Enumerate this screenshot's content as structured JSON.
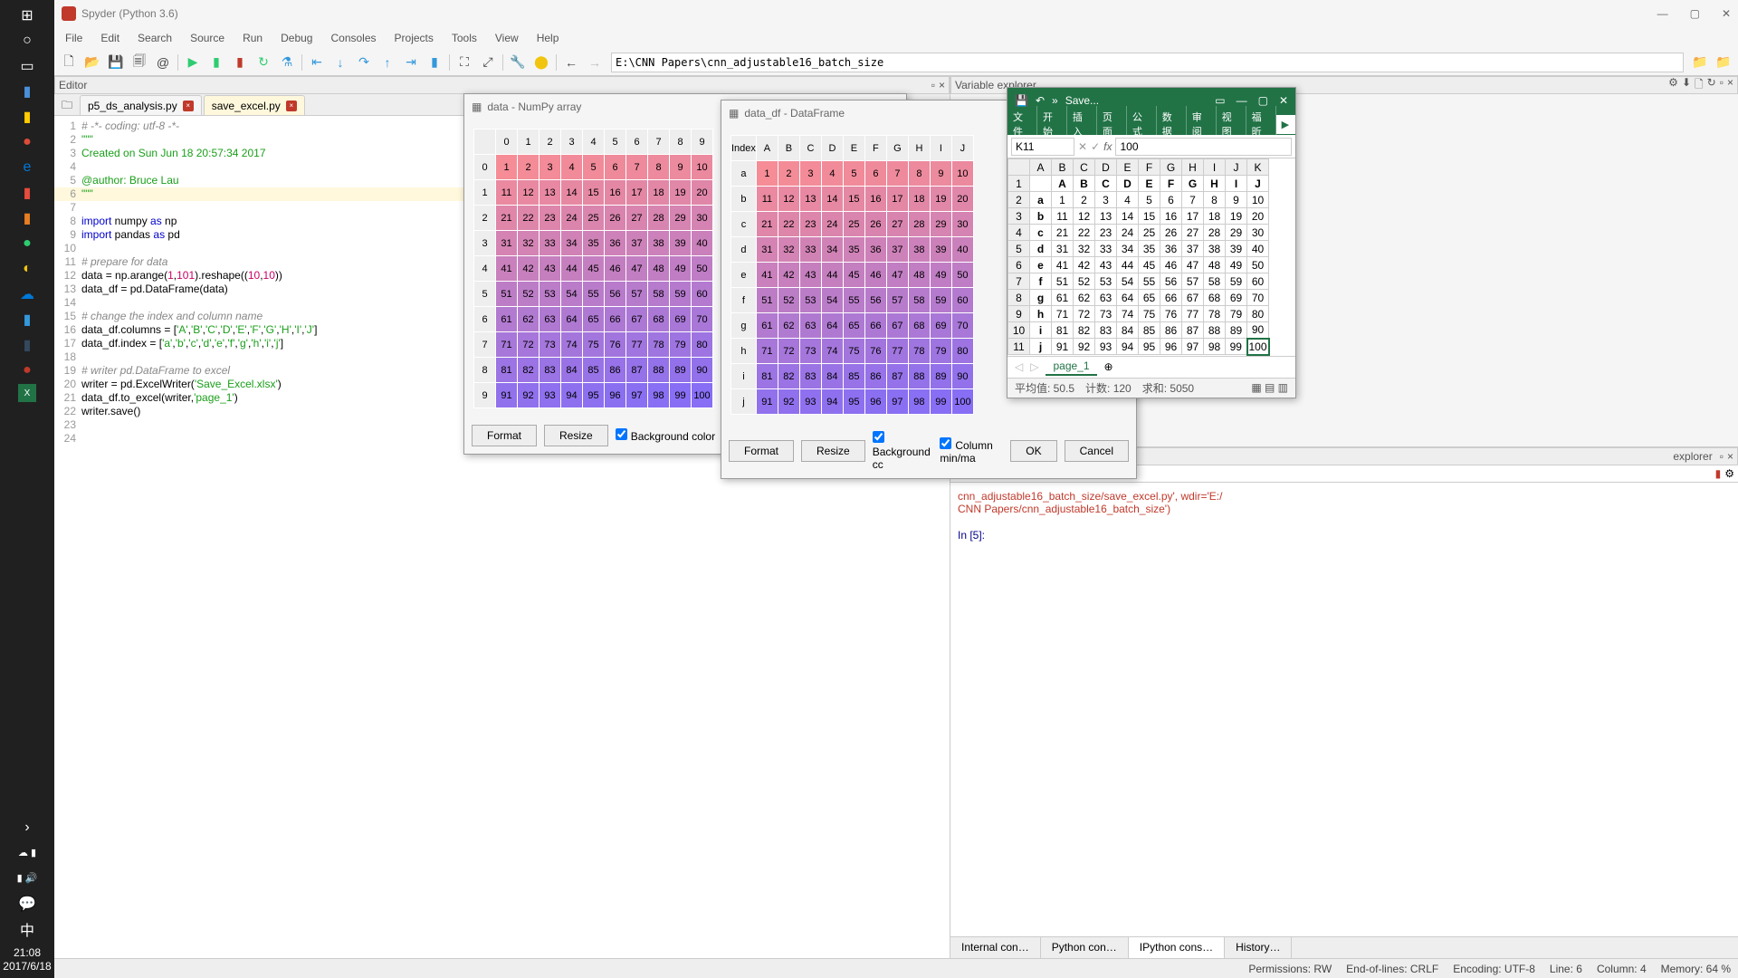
{
  "app": {
    "title": "Spyder (Python 3.6)"
  },
  "taskbar": {
    "time": "21:08",
    "date": "2017/6/18"
  },
  "menu": [
    "File",
    "Edit",
    "Search",
    "Source",
    "Run",
    "Debug",
    "Consoles",
    "Projects",
    "Tools",
    "View",
    "Help"
  ],
  "path": "E:\\CNN Papers\\cnn_adjustable16_batch_size",
  "editor_label": "Editor",
  "varexp_label": "Variable explorer",
  "tabs": [
    {
      "name": "p5_ds_analysis.py",
      "dirty": true
    },
    {
      "name": "save_excel.py",
      "dirty": true,
      "active": true
    }
  ],
  "code": [
    {
      "n": 1,
      "t": "# -*- coding: utf-8 -*-",
      "cls": "c-cmt"
    },
    {
      "n": 2,
      "t": "\"\"\"",
      "cls": "c-str"
    },
    {
      "n": 3,
      "t": "Created on Sun Jun 18 20:57:34 2017",
      "cls": "c-str"
    },
    {
      "n": 4,
      "t": "",
      "cls": ""
    },
    {
      "n": 5,
      "t": "@author: Bruce Lau",
      "cls": "c-str"
    },
    {
      "n": 6,
      "t": "\"\"\"",
      "cls": "c-str",
      "hl": true
    },
    {
      "n": 7,
      "t": "",
      "cls": ""
    },
    {
      "n": 8,
      "html": "<span class='c-kw'>import</span> numpy <span class='c-kw'>as</span> np"
    },
    {
      "n": 9,
      "html": "<span class='c-kw'>import</span> pandas <span class='c-kw'>as</span> pd"
    },
    {
      "n": 10,
      "t": "",
      "cls": ""
    },
    {
      "n": 11,
      "t": "# prepare for data",
      "cls": "c-cmt"
    },
    {
      "n": 12,
      "html": "data = np.arange(<span class='c-num'>1</span>,<span class='c-num'>101</span>).reshape((<span class='c-num'>10</span>,<span class='c-num'>10</span>))"
    },
    {
      "n": 13,
      "html": "data_df = pd.DataFrame(data)"
    },
    {
      "n": 14,
      "t": "",
      "cls": ""
    },
    {
      "n": 15,
      "t": "# change the index and column name",
      "cls": "c-cmt"
    },
    {
      "n": 16,
      "html": "data_df.columns = [<span class='c-str'>'A'</span>,<span class='c-str'>'B'</span>,<span class='c-str'>'C'</span>,<span class='c-str'>'D'</span>,<span class='c-str'>'E'</span>,<span class='c-str'>'F'</span>,<span class='c-str'>'G'</span>,<span class='c-str'>'H'</span>,<span class='c-str'>'I'</span>,<span class='c-str'>'J'</span>]"
    },
    {
      "n": 17,
      "html": "data_df.index = [<span class='c-str'>'a'</span>,<span class='c-str'>'b'</span>,<span class='c-str'>'c'</span>,<span class='c-str'>'d'</span>,<span class='c-str'>'e'</span>,<span class='c-str'>'f'</span>,<span class='c-str'>'g'</span>,<span class='c-str'>'h'</span>,<span class='c-str'>'i'</span>,<span class='c-str'>'j'</span>]"
    },
    {
      "n": 18,
      "t": "",
      "cls": ""
    },
    {
      "n": 19,
      "t": "# writer pd.DataFrame to excel",
      "cls": "c-cmt"
    },
    {
      "n": 20,
      "html": "writer = pd.ExcelWriter(<span class='c-str'>'Save_Excel.xlsx'</span>)"
    },
    {
      "n": 21,
      "html": "data_df.to_excel(writer,<span class='c-str'>'page_1'</span>)"
    },
    {
      "n": 22,
      "html": "writer.save()"
    },
    {
      "n": 23,
      "t": "",
      "cls": ""
    },
    {
      "n": 24,
      "t": "",
      "cls": ""
    }
  ],
  "numpy_popup": {
    "title": "data - NumPy array",
    "cols": [
      "0",
      "1",
      "2",
      "3",
      "4",
      "5",
      "6",
      "7",
      "8",
      "9"
    ],
    "rows": [
      "0",
      "1",
      "2",
      "3",
      "4",
      "5",
      "6",
      "7",
      "8",
      "9"
    ],
    "btns": {
      "format": "Format",
      "resize": "Resize",
      "bg": "Background color"
    }
  },
  "df_popup": {
    "title": "data_df - DataFrame",
    "indexlabel": "Index",
    "cols": [
      "A",
      "B",
      "C",
      "D",
      "E",
      "F",
      "G",
      "H",
      "I",
      "J"
    ],
    "rows": [
      "a",
      "b",
      "c",
      "d",
      "e",
      "f",
      "g",
      "h",
      "i",
      "j"
    ],
    "btns": {
      "format": "Format",
      "resize": "Resize",
      "bg": "Background cc",
      "minmax": "Column min/ma",
      "ok": "OK",
      "cancel": "Cancel"
    }
  },
  "grid_values": [
    [
      1,
      2,
      3,
      4,
      5,
      6,
      7,
      8,
      9,
      10
    ],
    [
      11,
      12,
      13,
      14,
      15,
      16,
      17,
      18,
      19,
      20
    ],
    [
      21,
      22,
      23,
      24,
      25,
      26,
      27,
      28,
      29,
      30
    ],
    [
      31,
      32,
      33,
      34,
      35,
      36,
      37,
      38,
      39,
      40
    ],
    [
      41,
      42,
      43,
      44,
      45,
      46,
      47,
      48,
      49,
      50
    ],
    [
      51,
      52,
      53,
      54,
      55,
      56,
      57,
      58,
      59,
      60
    ],
    [
      61,
      62,
      63,
      64,
      65,
      66,
      67,
      68,
      69,
      70
    ],
    [
      71,
      72,
      73,
      74,
      75,
      76,
      77,
      78,
      79,
      80
    ],
    [
      81,
      82,
      83,
      84,
      85,
      86,
      87,
      88,
      89,
      90
    ],
    [
      91,
      92,
      93,
      94,
      95,
      96,
      97,
      98,
      99,
      100
    ]
  ],
  "excel": {
    "save": "Save...",
    "ribbon": [
      "文件",
      "开始",
      "插入",
      "页面",
      "公式",
      "数据",
      "审阅",
      "视图",
      "福昕"
    ],
    "cellref": "K11",
    "cellval": "100",
    "cols": [
      "A",
      "B",
      "C",
      "D",
      "E",
      "F",
      "G",
      "H",
      "I",
      "J",
      "K"
    ],
    "header": [
      "",
      "A",
      "B",
      "C",
      "D",
      "E",
      "F",
      "G",
      "H",
      "I",
      "J"
    ],
    "rows": [
      "a",
      "b",
      "c",
      "d",
      "e",
      "f",
      "g",
      "h",
      "i",
      "j"
    ],
    "sheet": "page_1",
    "status": {
      "avg": "平均值: 50.5",
      "count": "计数: 120",
      "sum": "求和: 5050"
    }
  },
  "console": {
    "runline": "cnn_adjustable16_batch_size/save_excel.py', wdir='E:/",
    "runline2": "CNN Papers/cnn_adjustable16_batch_size')",
    "prompt": "In [5]:",
    "tabs": [
      "Internal con…",
      "Python con…",
      "IPython cons…",
      "History…"
    ],
    "explorer": "explorer"
  },
  "status": {
    "perm": "Permissions: RW",
    "eol": "End-of-lines: CRLF",
    "enc": "Encoding: UTF-8",
    "line": "Line: 6",
    "col": "Column: 4",
    "mem": "Memory: 64 %"
  }
}
